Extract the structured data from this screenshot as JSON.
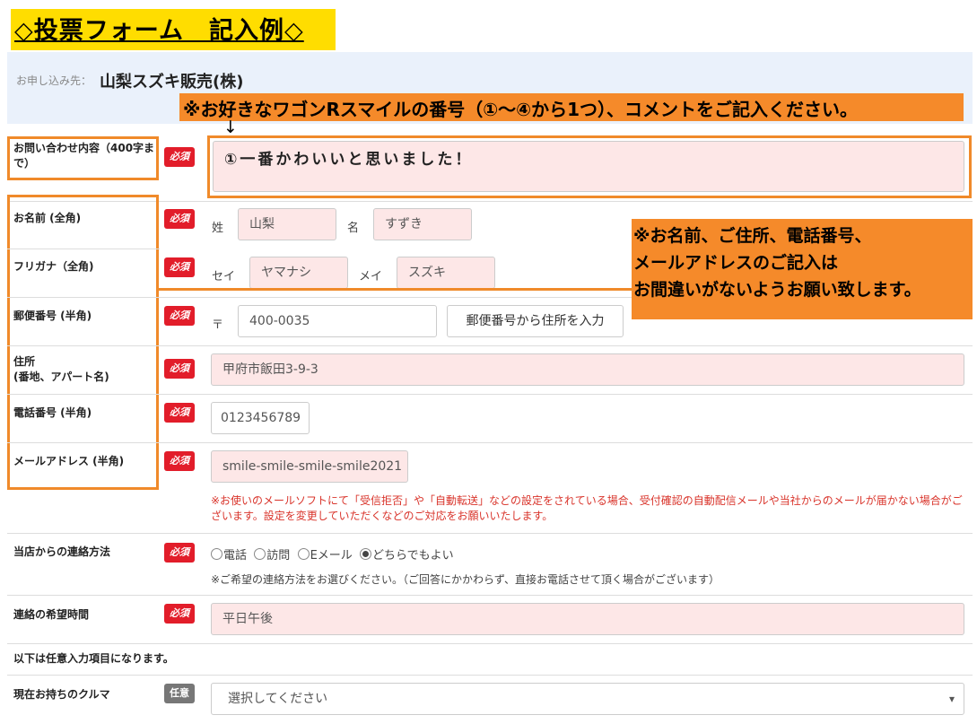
{
  "title": "◇投票フォーム　記入例◇",
  "destination": {
    "label": "お申し込み先：",
    "value": "山梨スズキ販売(株)"
  },
  "banner_top": "※お好きなワゴンRスマイルの番号（①～④から1つ）、コメントをご記入ください。",
  "arrow": "↓",
  "required_badge": "必須",
  "optional_badge": "任意",
  "inquiry": {
    "label": "お問い合わせ内容（400字まで）",
    "value": "①一番かわいいと思いました！"
  },
  "name": {
    "label": "お名前 (全角)",
    "sei_label": "姓",
    "sei_value": "山梨",
    "mei_label": "名",
    "mei_value": "すずき"
  },
  "kana": {
    "label": "フリガナ（全角)",
    "sei_label": "セイ",
    "sei_value": "ヤマナシ",
    "mei_label": "メイ",
    "mei_value": "スズキ"
  },
  "zip": {
    "label": "郵便番号 (半角)",
    "mark": "〒",
    "value": "400-0035",
    "button": "郵便番号から住所を入力"
  },
  "address": {
    "label_line1": "住所",
    "label_line2": "(番地、アパート名)",
    "value": "甲府市飯田3-9-3"
  },
  "phone": {
    "label": "電話番号 (半角)",
    "value": "0123456789"
  },
  "email": {
    "label": "メールアドレス (半角)",
    "value": "smile-smile-smile-smile2021",
    "note": "※お使いのメールソフトにて「受信拒否」や「自動転送」などの設定をされている場合、受付確認の自動配信メールや当社からのメールが届かない場合がございます。設定を変更していただくなどのご対応をお願いいたします。"
  },
  "right_note": {
    "line1": "※お名前、ご住所、電話番号、",
    "line2": "メールアドレスのご記入は",
    "line3": "お間違いがないようお願い致します。"
  },
  "contact_method": {
    "label": "当店からの連絡方法",
    "options": [
      "電話",
      "訪問",
      "Eメール",
      "どちらでもよい"
    ],
    "selected": "どちらでもよい",
    "note": "※ご希望の連絡方法をお選びください。（ご回答にかかわらず、直接お電話させて頂く場合がございます）"
  },
  "contact_time": {
    "label": "連絡の希望時間",
    "value": "平日午後"
  },
  "optional_heading": "以下は任意入力項目になります。",
  "car": {
    "label": "現在お持ちのクルマ",
    "placeholder": "選択してください",
    "caret": "▾"
  }
}
